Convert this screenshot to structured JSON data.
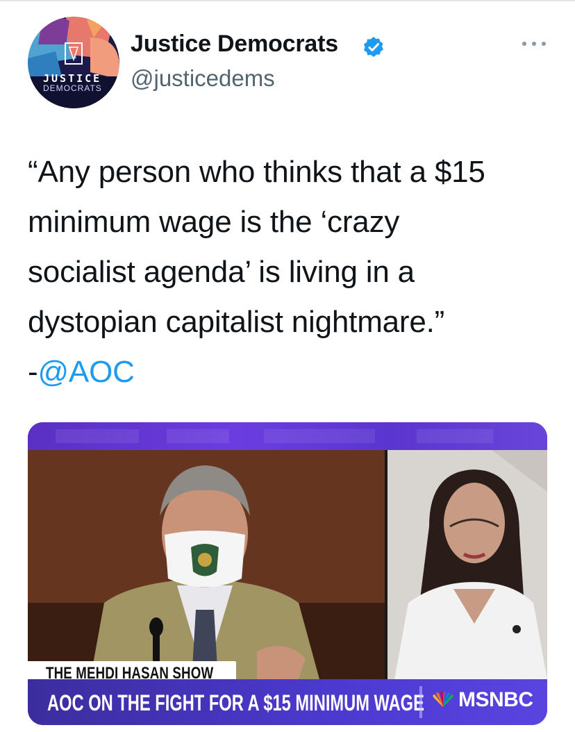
{
  "account": {
    "display_name": "Justice Democrats",
    "handle": "@justicedems",
    "avatar_text_top": "JUSTICE",
    "avatar_text_bottom": "DEMOCRATS",
    "verified": true,
    "verified_color": "#1d9bf0"
  },
  "tweet": {
    "lines": [
      "“Any person who thinks that a $15",
      "minimum wage is the ‘crazy",
      "socialist agenda’ is living in a",
      "dystopian capitalist nightmare.”"
    ],
    "attribution_prefix": "-",
    "mention": "@AOC",
    "mention_color": "#1d9bf0"
  },
  "media": {
    "show_title": "THE MEHDI HASAN SHOW",
    "headline": "AOC ON THE FIGHT FOR A $15 MINIMUM WAGE",
    "network": "MSNBC",
    "bar_color": "#4c3ad0"
  },
  "icons": {
    "more": "more-horizontal-icon",
    "verified": "verified-badge-icon",
    "network_logo": "peacock-logo-icon"
  }
}
